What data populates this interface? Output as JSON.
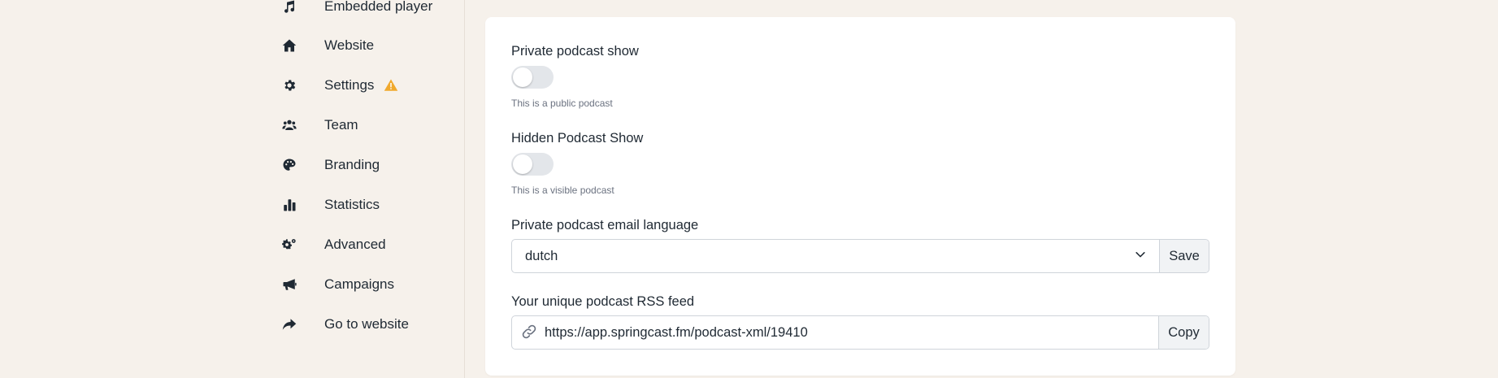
{
  "sidebar": {
    "items": [
      {
        "label": "Embedded player",
        "icon": "music-note-icon"
      },
      {
        "label": "Website",
        "icon": "home-icon"
      },
      {
        "label": "Settings",
        "icon": "gear-icon",
        "warning": true
      },
      {
        "label": "Team",
        "icon": "users-icon"
      },
      {
        "label": "Branding",
        "icon": "palette-icon"
      },
      {
        "label": "Statistics",
        "icon": "bar-chart-icon"
      },
      {
        "label": "Advanced",
        "icon": "gears-icon"
      },
      {
        "label": "Campaigns",
        "icon": "megaphone-icon"
      },
      {
        "label": "Go to website",
        "icon": "share-arrow-icon"
      }
    ],
    "warning_color": "#f0a92d"
  },
  "settings": {
    "private_show": {
      "label": "Private podcast show",
      "help": "This is a public podcast",
      "enabled": false
    },
    "hidden_show": {
      "label": "Hidden Podcast Show",
      "help": "This is a visible podcast",
      "enabled": false
    },
    "email_language": {
      "label": "Private podcast email language",
      "selected": "dutch",
      "save_label": "Save"
    },
    "rss_feed": {
      "label": "Your unique podcast RSS feed",
      "value": "https://app.springcast.fm/podcast-xml/19410",
      "copy_label": "Copy"
    }
  }
}
